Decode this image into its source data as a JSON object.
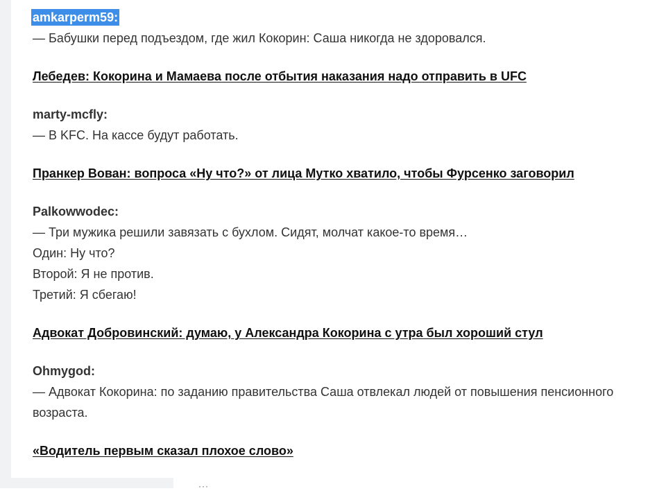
{
  "comments": [
    {
      "author": "amkarperm59:",
      "lines": [
        "— Бабушки перед подъездом, где жил Кокорин: Саша никогда не здоровался."
      ]
    },
    {
      "link": "Лебедев: Кокорина и Мамаева после отбытия наказания надо отправить в UFC"
    },
    {
      "author": "marty-mcfly:",
      "lines": [
        "— В KFC. На кассе будут работать."
      ]
    },
    {
      "link": "Пранкер Вован: вопроса «Ну что?» от лица Мутко хватило, чтобы Фурсенко заговорил"
    },
    {
      "author": "Palkowwodec:",
      "lines": [
        "— Три мужика решили завязать с бухлом. Сидят, молчат какое-то время…",
        "Один: Ну что?",
        "Второй: Я не против.",
        "Третий: Я сбегаю!"
      ]
    },
    {
      "link": "Адвокат Добровинский: думаю, у Александра Кокорина с утра был хороший стул"
    },
    {
      "author": "Ohmygod:",
      "lines": [
        "— Адвокат Кокорина: по заданию правительства Саша отвлекал людей от повышения пенсионного",
        "возраста."
      ]
    },
    {
      "link": "«Водитель первым сказал плохое слово»"
    }
  ],
  "bottom_mark": "···"
}
